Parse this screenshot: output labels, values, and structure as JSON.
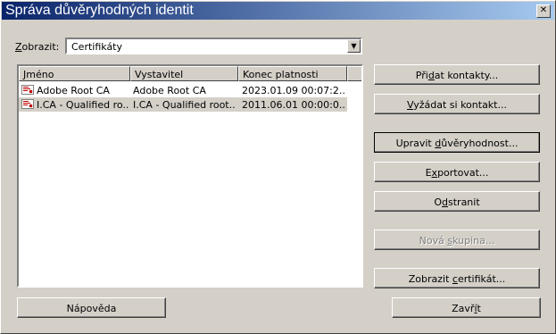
{
  "window": {
    "title": "Správa důvěryhodných identit",
    "close_glyph": "✕"
  },
  "filter": {
    "label_prefix": "",
    "label_key": "Z",
    "label_rest": "obrazit:",
    "value": "Certifikáty"
  },
  "list": {
    "columns": [
      "Jméno",
      "Vystavitel",
      "Konec platnosti"
    ],
    "rows": [
      {
        "name": "Adobe Root CA",
        "issuer": "Adobe Root CA",
        "expires": "2023.01.09 00:07:2..."
      },
      {
        "name": "I.CA - Qualified ro...",
        "issuer": "I.CA - Qualified root...",
        "expires": "2011.06.01 00:00:0..."
      }
    ]
  },
  "buttons": {
    "add_contacts": {
      "pre": "Při",
      "key": "d",
      "post": "at kontakty..."
    },
    "request_contact": {
      "pre": "",
      "key": "V",
      "post": "yžádat si kontakt..."
    },
    "edit_trust": {
      "pre": "Upravit ",
      "key": "d",
      "post": "ůvěryhodnost..."
    },
    "export": {
      "pre": "E",
      "key": "x",
      "post": "portovat..."
    },
    "delete": {
      "pre": "O",
      "key": "d",
      "post": "stranit"
    },
    "new_group": {
      "pre": "Nová ",
      "key": "s",
      "post": "kupina..."
    },
    "show_cert": {
      "pre": "Zobrazit ",
      "key": "c",
      "post": "ertifikát..."
    },
    "help": {
      "pre": "Nápověda",
      "key": "",
      "post": ""
    },
    "close": {
      "pre": "Zavř",
      "key": "í",
      "post": "t"
    }
  }
}
